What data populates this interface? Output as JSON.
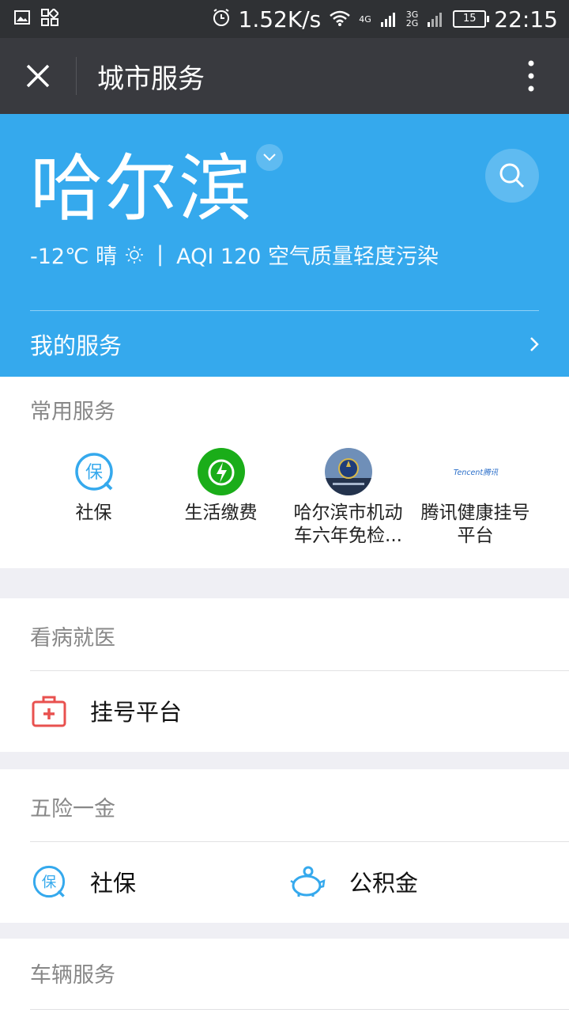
{
  "status_bar": {
    "speed": "1.52K/s",
    "network_1": "4G",
    "network_2a": "3G",
    "network_2b": "2G",
    "battery": "15",
    "time": "22:15"
  },
  "title_bar": {
    "title": "城市服务"
  },
  "hero": {
    "city": "哈尔滨",
    "weather": "-12℃ 晴",
    "aqi": "AQI 120 空气质量轻度污染",
    "my_services": "我的服务"
  },
  "common": {
    "header": "常用服务",
    "items": [
      {
        "label": "社保",
        "icon": "social-insurance-icon"
      },
      {
        "label": "生活缴费",
        "icon": "utility-payment-icon"
      },
      {
        "label": "哈尔滨市机动车六年免检...",
        "icon": "police-emblem-icon"
      },
      {
        "label": "腾讯健康挂号平台",
        "icon": "tencent-logo-icon",
        "logo_text": "Tencent腾讯"
      }
    ]
  },
  "medical": {
    "header": "看病就医",
    "items": [
      {
        "label": "挂号平台",
        "icon": "medical-kit-icon"
      }
    ]
  },
  "insurance": {
    "header": "五险一金",
    "items": [
      {
        "label": "社保",
        "icon": "social-insurance-icon"
      },
      {
        "label": "公积金",
        "icon": "piggy-bank-icon"
      }
    ]
  },
  "vehicle": {
    "header": "车辆服务"
  },
  "colors": {
    "accent": "#35a9ed",
    "titlebar": "#393a3f",
    "green": "#1aad19",
    "red": "#e8514f"
  }
}
